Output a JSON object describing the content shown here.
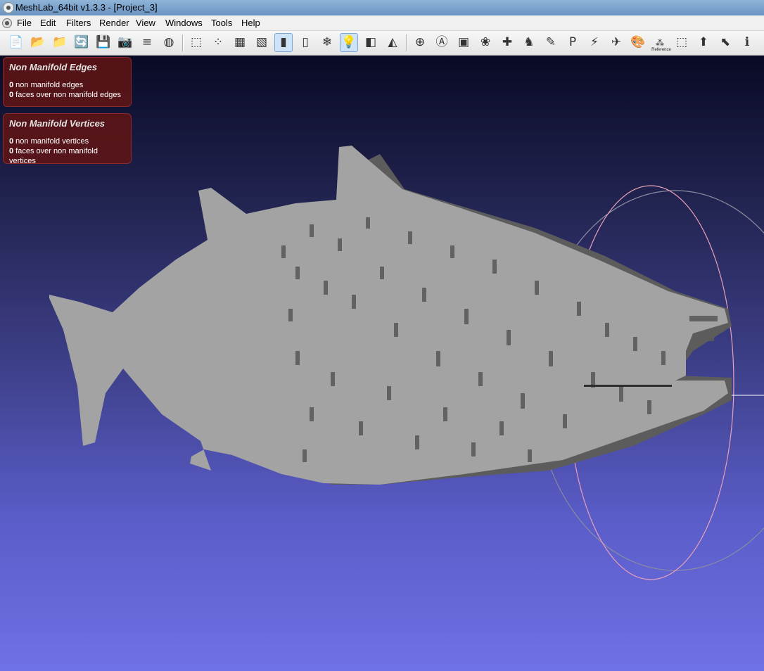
{
  "window": {
    "title": "MeshLab_64bit v1.3.3 - [Project_3]"
  },
  "menu": [
    "File",
    "Edit",
    "Filters",
    "Render",
    "View",
    "Windows",
    "Tools",
    "Help"
  ],
  "toolbar": {
    "buttons": [
      {
        "name": "new-project-icon",
        "glyph": "📄"
      },
      {
        "name": "open-project-icon",
        "glyph": "📂"
      },
      {
        "name": "import-mesh-icon",
        "glyph": "📁"
      },
      {
        "name": "reload-icon",
        "glyph": "🔄"
      },
      {
        "name": "export-mesh-icon",
        "glyph": "💾"
      },
      {
        "name": "snapshot-icon",
        "glyph": "📷"
      },
      {
        "name": "layers-icon",
        "glyph": "≡"
      },
      {
        "name": "raster-icon",
        "glyph": "◍"
      },
      {
        "name": "bounding-box-icon",
        "glyph": "⬚"
      },
      {
        "name": "points-icon",
        "glyph": "⁘"
      },
      {
        "name": "wireframe-icon",
        "glyph": "▦"
      },
      {
        "name": "hidden-lines-icon",
        "glyph": "▧"
      },
      {
        "name": "flat-shading-icon",
        "glyph": "▮",
        "active": true
      },
      {
        "name": "smooth-shading-icon",
        "glyph": "▯"
      },
      {
        "name": "texture-icon",
        "glyph": "❄"
      },
      {
        "name": "light-icon",
        "glyph": "💡",
        "active": true
      },
      {
        "name": "back-face-icon",
        "glyph": "◧"
      },
      {
        "name": "select-faces-icon",
        "glyph": "◭"
      },
      {
        "name": "sphere-icon",
        "glyph": "⊕"
      },
      {
        "name": "align-icon",
        "glyph": "Ⓐ"
      },
      {
        "name": "measure-icon",
        "glyph": "▣"
      },
      {
        "name": "paint-icon",
        "glyph": "❀"
      },
      {
        "name": "axis-icon",
        "glyph": "✚"
      },
      {
        "name": "manipulator-icon",
        "glyph": "♞"
      },
      {
        "name": "brush-icon",
        "glyph": "✎"
      },
      {
        "name": "pickpoints-icon",
        "glyph": "P"
      },
      {
        "name": "quality-icon",
        "glyph": "⚡"
      },
      {
        "name": "point-picking-icon",
        "glyph": "✈"
      },
      {
        "name": "color-icon",
        "glyph": "🎨"
      },
      {
        "name": "reference-icon",
        "glyph": "⁂",
        "label": "Reference"
      },
      {
        "name": "select-vertices-icon",
        "glyph": "⬚"
      },
      {
        "name": "select-connected-icon",
        "glyph": "⬆"
      },
      {
        "name": "select-region-icon",
        "glyph": "⬉"
      },
      {
        "name": "info-icon",
        "glyph": "ℹ"
      }
    ]
  },
  "panels": {
    "edges": {
      "title": "Non Manifold Edges",
      "lines": [
        {
          "count": "0",
          "text": " non manifold edges"
        },
        {
          "count": "0",
          "text": " faces over non manifold edges"
        }
      ]
    },
    "vertices": {
      "title": "Non Manifold Vertices",
      "lines": [
        {
          "count": "0",
          "text": " non manifold vertices"
        },
        {
          "count": "0",
          "text": " faces over non manifold vertices"
        }
      ]
    }
  },
  "colors": {
    "mesh_light": "#a3a3a3",
    "mesh_dark": "#5c5c5c",
    "trackball_red": "#e8a0b8",
    "trackball_green": "#8c8c9a"
  }
}
